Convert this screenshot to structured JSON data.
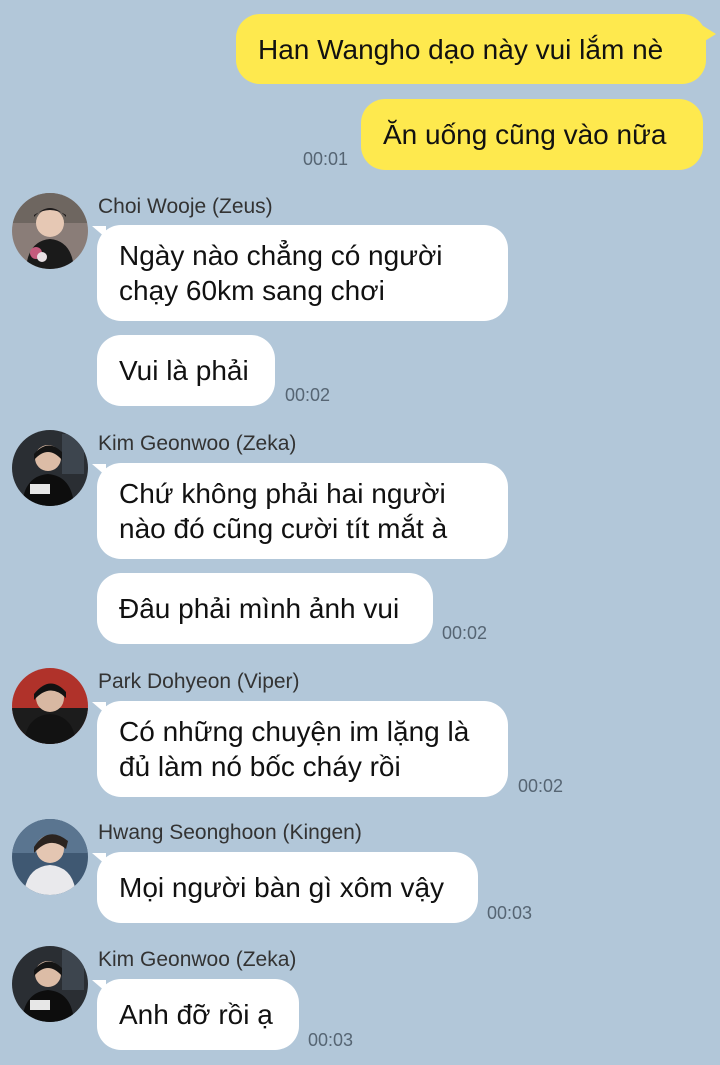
{
  "messages_me": [
    {
      "text": "Han Wangho dạo này vui lắm nè"
    },
    {
      "text": "Ăn uống cũng vào nữa",
      "time": "00:01"
    }
  ],
  "groups": [
    {
      "sender": "Choi Wooje (Zeus)",
      "avatar": "zeus-avatar",
      "bubbles": [
        "Ngày nào chẳng có người\nchạy 60km sang chơi",
        "Vui là phải"
      ],
      "time": "00:02"
    },
    {
      "sender": "Kim Geonwoo (Zeka)",
      "avatar": "zeka-avatar",
      "bubbles": [
        "Chứ không phải hai người\nnào đó cũng cười tít mắt à",
        "Đâu phải mình ảnh vui"
      ],
      "time": "00:02"
    },
    {
      "sender": "Park Dohyeon (Viper)",
      "avatar": "viper-avatar",
      "bubbles": [
        "Có những chuyện im lặng là\nđủ làm nó bốc cháy rồi"
      ],
      "time": "00:02"
    },
    {
      "sender": "Hwang Seonghoon (Kingen)",
      "avatar": "kingen-avatar",
      "bubbles": [
        "Mọi người bàn gì xôm vậy"
      ],
      "time": "00:03"
    },
    {
      "sender": "Kim Geonwoo (Zeka)",
      "avatar": "zeka-avatar",
      "bubbles": [
        "Anh đỡ rồi ạ"
      ],
      "time": "00:03"
    }
  ],
  "colors": {
    "background": "#b2c7d9",
    "my_bubble": "#fee94e",
    "other_bubble": "#ffffff"
  }
}
